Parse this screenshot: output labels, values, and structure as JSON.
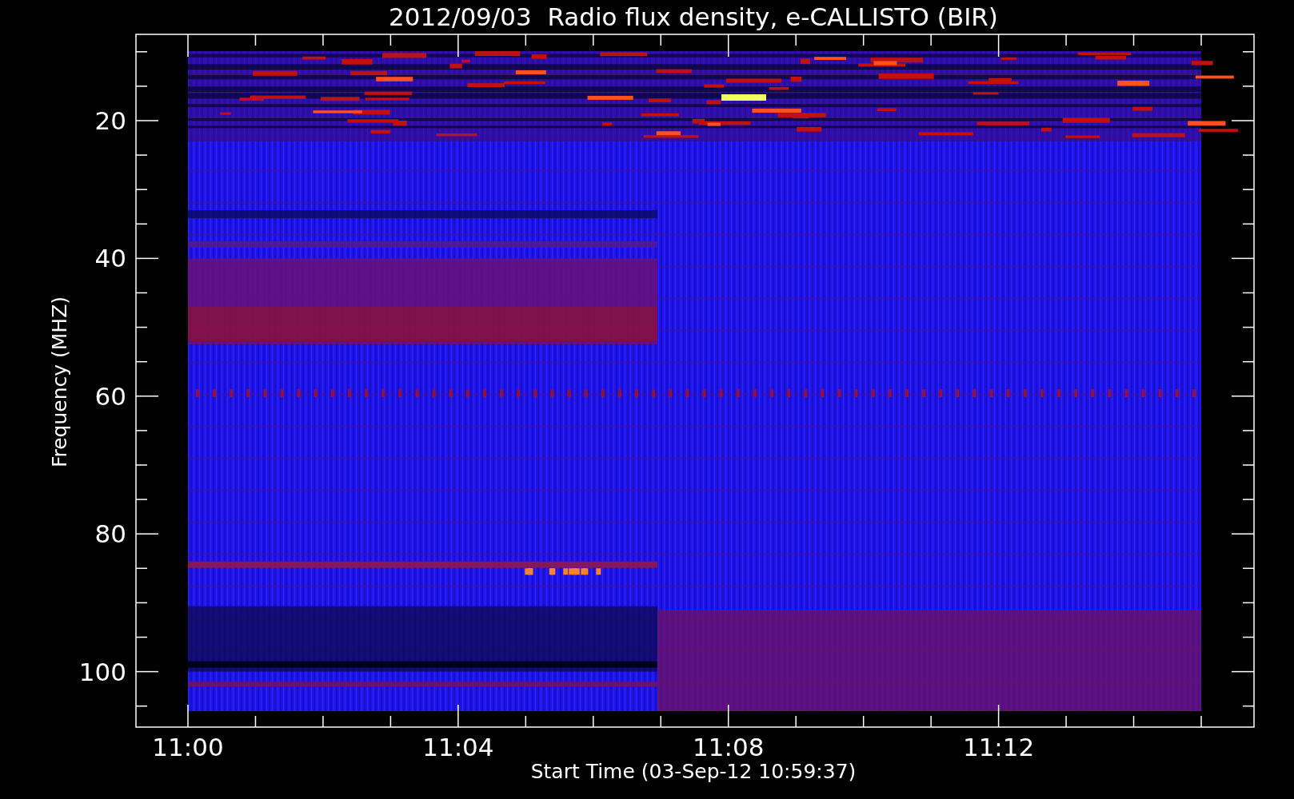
{
  "title": "2012/09/03  Radio flux density, e-CALLISTO (BIR)",
  "y_axis": {
    "label": "Frequency (MHZ)",
    "ticks": [
      "20",
      "40",
      "60",
      "80",
      "100"
    ]
  },
  "x_axis": {
    "label": "Start Time (03-Sep-12 10:59:37)",
    "ticks": [
      "11:00",
      "11:04",
      "11:08",
      "11:12"
    ]
  }
}
